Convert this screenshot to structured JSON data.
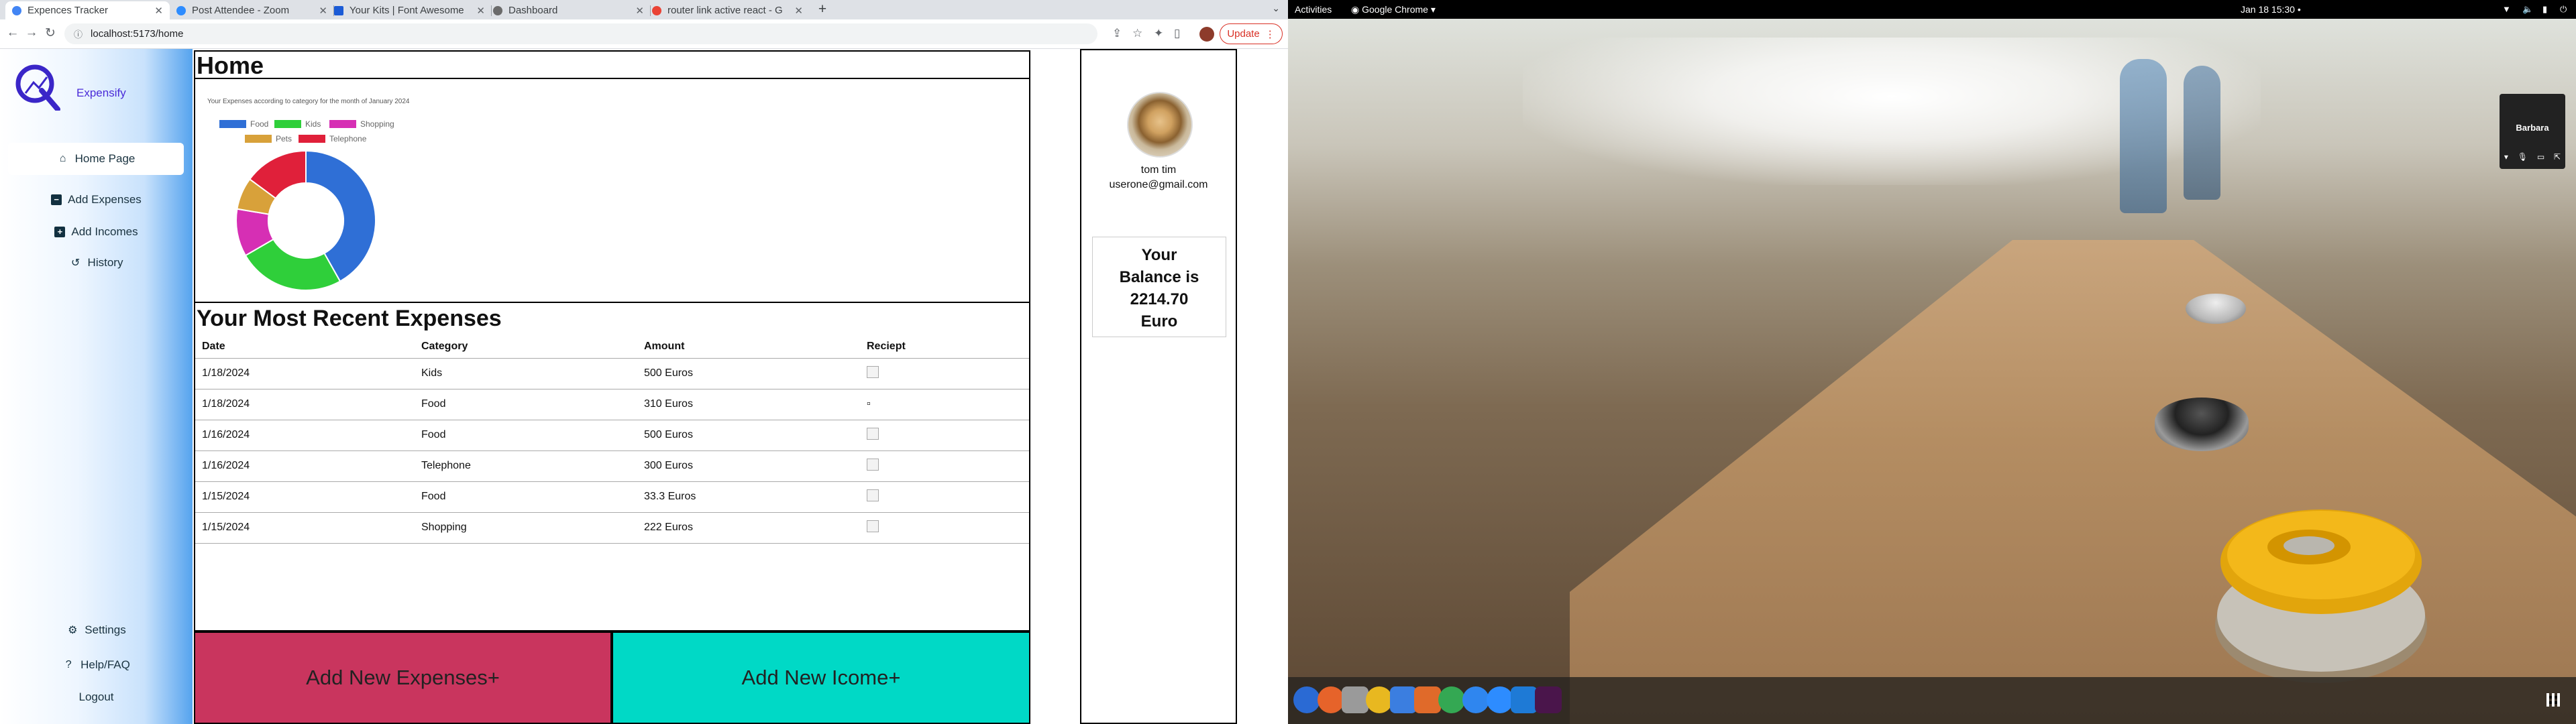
{
  "browser": {
    "tabs": [
      {
        "title": "Expences Tracker",
        "active": true,
        "color": "#4285f4"
      },
      {
        "title": "Post Attendee - Zoom",
        "active": false,
        "color": "#2d8cff"
      },
      {
        "title": "Your Kits | Font Awesome",
        "active": false,
        "color": "#1b5bd6"
      },
      {
        "title": "Dashboard",
        "active": false,
        "color": "#6b6b6b"
      },
      {
        "title": "router link active react - G",
        "active": false,
        "color": "#ea4335"
      }
    ],
    "url": "localhost:5173/home",
    "update_label": "Update"
  },
  "app": {
    "brand": "Expensify",
    "nav": [
      {
        "label": "Home Page",
        "icon": "home-icon"
      },
      {
        "label": "Add Expenses",
        "icon": "minus-square-icon"
      },
      {
        "label": "Add Incomes",
        "icon": "plus-square-icon"
      },
      {
        "label": "History",
        "icon": "history-icon"
      }
    ],
    "bottom_nav": [
      {
        "label": "Settings",
        "icon": "gear-icon"
      },
      {
        "label": "Help/FAQ",
        "icon": "question-icon"
      },
      {
        "label": "Logout",
        "icon": ""
      }
    ],
    "page_title": "Home",
    "recent_title": "Your Most Recent Expenses",
    "table": {
      "headers": [
        "Date",
        "Category",
        "Amount",
        "Reciept"
      ],
      "rows": [
        [
          "1/18/2024",
          "Kids",
          "500 Euros"
        ],
        [
          "1/18/2024",
          "Food",
          "310 Euros"
        ],
        [
          "1/16/2024",
          "Food",
          "500 Euros"
        ],
        [
          "1/16/2024",
          "Telephone",
          "300 Euros"
        ],
        [
          "1/15/2024",
          "Food",
          "33.3 Euros"
        ],
        [
          "1/15/2024",
          "Shopping",
          "222 Euros"
        ]
      ]
    },
    "add_expense_label": "Add New Expenses+",
    "add_income_label": "Add New Icome+",
    "profile": {
      "name": "tom tim",
      "email": "userone@gmail.com",
      "balance_lines": [
        "Your",
        "Balance is",
        "2214.70",
        "Euro"
      ]
    }
  },
  "chart_data": {
    "type": "pie",
    "title": "Your Expenses according to category for the month of January 2024",
    "categories": [
      "Food",
      "Kids",
      "Shopping",
      "Pets",
      "Telephone"
    ],
    "values": [
      843.3,
      500,
      222,
      150,
      300
    ],
    "colors": [
      "#2f6fd6",
      "#2fcf3a",
      "#d62fb4",
      "#d8a13a",
      "#e0203a"
    ],
    "donut": true,
    "legend_position": "top"
  },
  "desktop": {
    "activities": "Activities",
    "app_menu": "Google Chrome",
    "datetime": "Jan 18  15:30",
    "meeting_name": "Barbara"
  }
}
